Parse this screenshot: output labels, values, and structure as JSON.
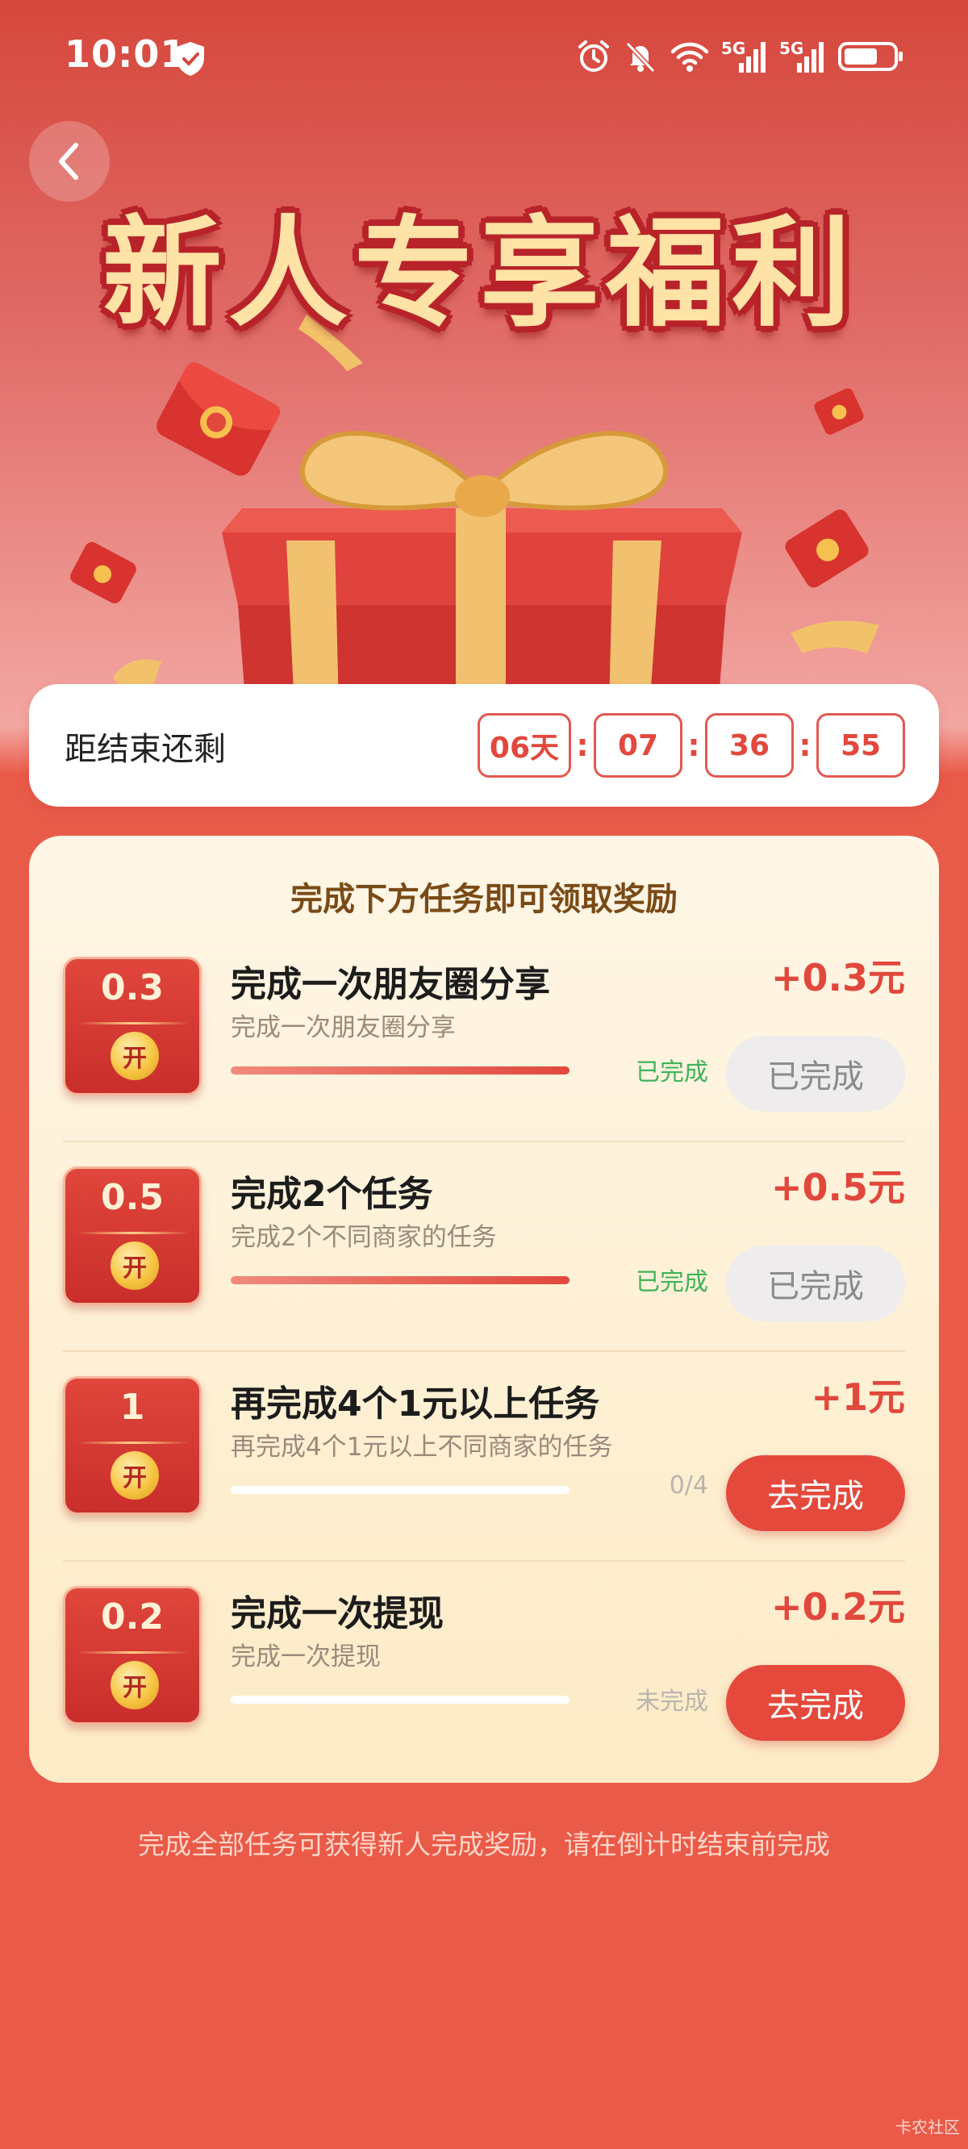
{
  "status_bar": {
    "time": "10:01",
    "network_a": "5G",
    "network_b": "5G"
  },
  "hero": {
    "title": "新人专享福利"
  },
  "countdown": {
    "label": "距结束还剩",
    "days": "06天",
    "hours": "07",
    "minutes": "36",
    "seconds": "55",
    "separator": ":"
  },
  "tasks": {
    "heading": "完成下方任务即可领取奖励",
    "coin_label": "开",
    "items": [
      {
        "coupon_value": "0.3",
        "title": "完成一次朋友圈分享",
        "desc": "完成一次朋友圈分享",
        "progress": 1.0,
        "status": "已完成",
        "reward": "+0.3元",
        "button": "已完成",
        "state": "done"
      },
      {
        "coupon_value": "0.5",
        "title": "完成2个任务",
        "desc": "完成2个不同商家的任务",
        "progress": 1.0,
        "status": "已完成",
        "reward": "+0.5元",
        "button": "已完成",
        "state": "done"
      },
      {
        "coupon_value": "1",
        "title": "再完成4个1元以上任务",
        "desc": "再完成4个1元以上不同商家的任务",
        "progress": 0.0,
        "status": "0/4",
        "reward": "+1元",
        "button": "去完成",
        "state": "todo"
      },
      {
        "coupon_value": "0.2",
        "title": "完成一次提现",
        "desc": "完成一次提现",
        "progress": 0.0,
        "status": "未完成",
        "reward": "+0.2元",
        "button": "去完成",
        "state": "todo"
      }
    ]
  },
  "footer_note": "完成全部任务可获得新人完成奖励，请在倒计时结束前完成",
  "watermark": "卡农社区",
  "colors": {
    "accent_red": "#e1483c",
    "done_green": "#3fb35a",
    "muted_gray": "#b9b4ad"
  }
}
